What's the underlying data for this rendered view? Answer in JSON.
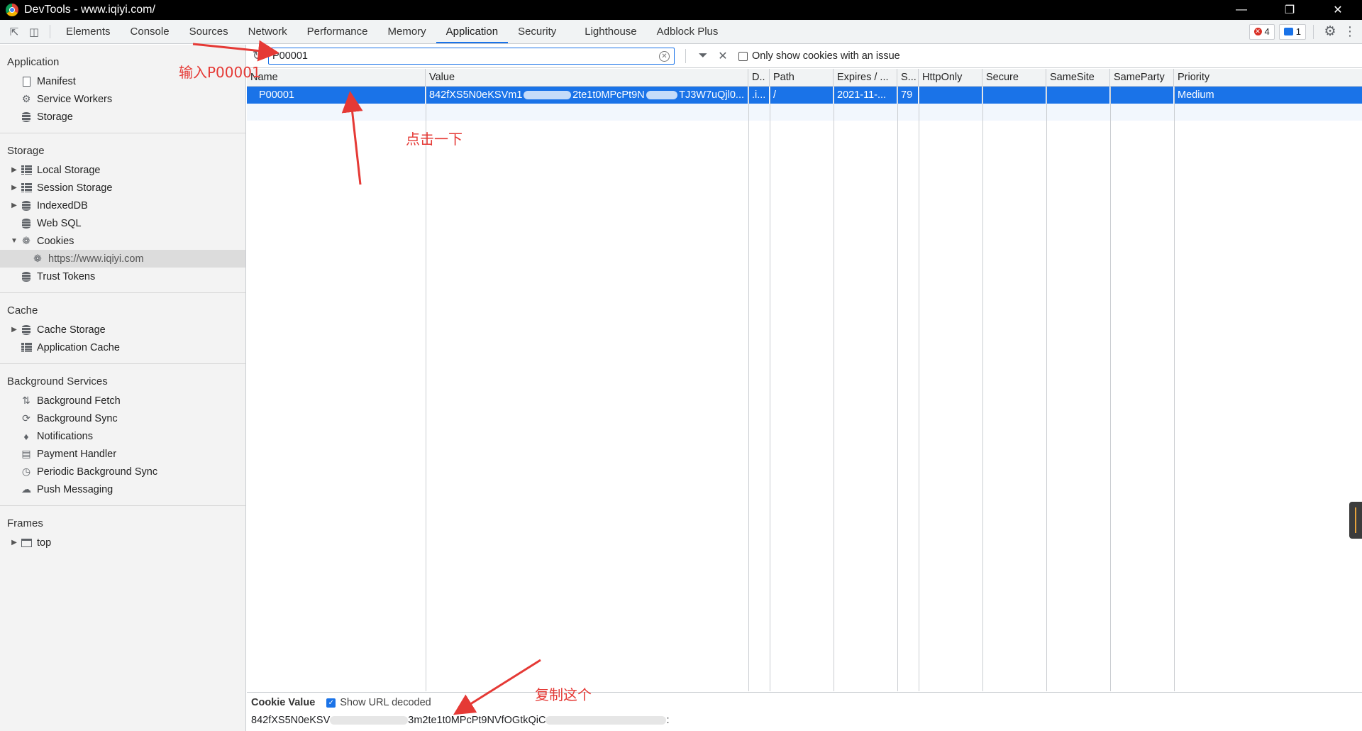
{
  "window": {
    "title": "DevTools - www.iqiyi.com/"
  },
  "toolbar": {
    "tabs": [
      {
        "label": "Elements"
      },
      {
        "label": "Console"
      },
      {
        "label": "Sources"
      },
      {
        "label": "Network"
      },
      {
        "label": "Performance"
      },
      {
        "label": "Memory"
      },
      {
        "label": "Application"
      },
      {
        "label": "Security"
      },
      {
        "label": "Lighthouse"
      },
      {
        "label": "Adblock Plus"
      }
    ],
    "active_tab": "Application",
    "error_count": "4",
    "message_count": "1"
  },
  "sidebar": {
    "application": {
      "title": "Application",
      "items": [
        "Manifest",
        "Service Workers",
        "Storage"
      ]
    },
    "storage": {
      "title": "Storage",
      "items": [
        "Local Storage",
        "Session Storage",
        "IndexedDB",
        "Web SQL",
        "Cookies",
        "https://www.iqiyi.com",
        "Trust Tokens"
      ]
    },
    "cache": {
      "title": "Cache",
      "items": [
        "Cache Storage",
        "Application Cache"
      ]
    },
    "background": {
      "title": "Background Services",
      "items": [
        "Background Fetch",
        "Background Sync",
        "Notifications",
        "Payment Handler",
        "Periodic Background Sync",
        "Push Messaging"
      ]
    },
    "frames": {
      "title": "Frames",
      "items": [
        "top"
      ]
    }
  },
  "filter": {
    "value": "P00001",
    "only_issue_label": "Only show cookies with an issue"
  },
  "table": {
    "headers": [
      "Name",
      "Value",
      "D..",
      "Path",
      "Expires / ...",
      "S...",
      "HttpOnly",
      "Secure",
      "SameSite",
      "SameParty",
      "Priority"
    ],
    "row": {
      "name": "P00001",
      "value_start": "842fXS5N0eKSVm1",
      "value_mid": "2te1t0MPcPt9N",
      "value_end": "TJ3W7uQjl0...",
      "domain": ".i...",
      "path": "/",
      "expires": "2021-11-...",
      "size": "79",
      "httponly": "",
      "secure": "",
      "samesite": "",
      "sameparty": "",
      "priority": "Medium"
    }
  },
  "cookie_panel": {
    "title": "Cookie Value",
    "show_decoded_label": "Show URL decoded",
    "value_start": "842fXS5N0eKSV",
    "value_mid": "3m2te1t0MPcPt9NVfOGtkQiC",
    "value_end": ":"
  },
  "annotations": {
    "input_label": "输入P00001",
    "click_label": "点击一下",
    "copy_label": "复制这个"
  },
  "colors": {
    "accent": "#1a73e8",
    "annotation": "#e53935",
    "error": "#d93025"
  }
}
